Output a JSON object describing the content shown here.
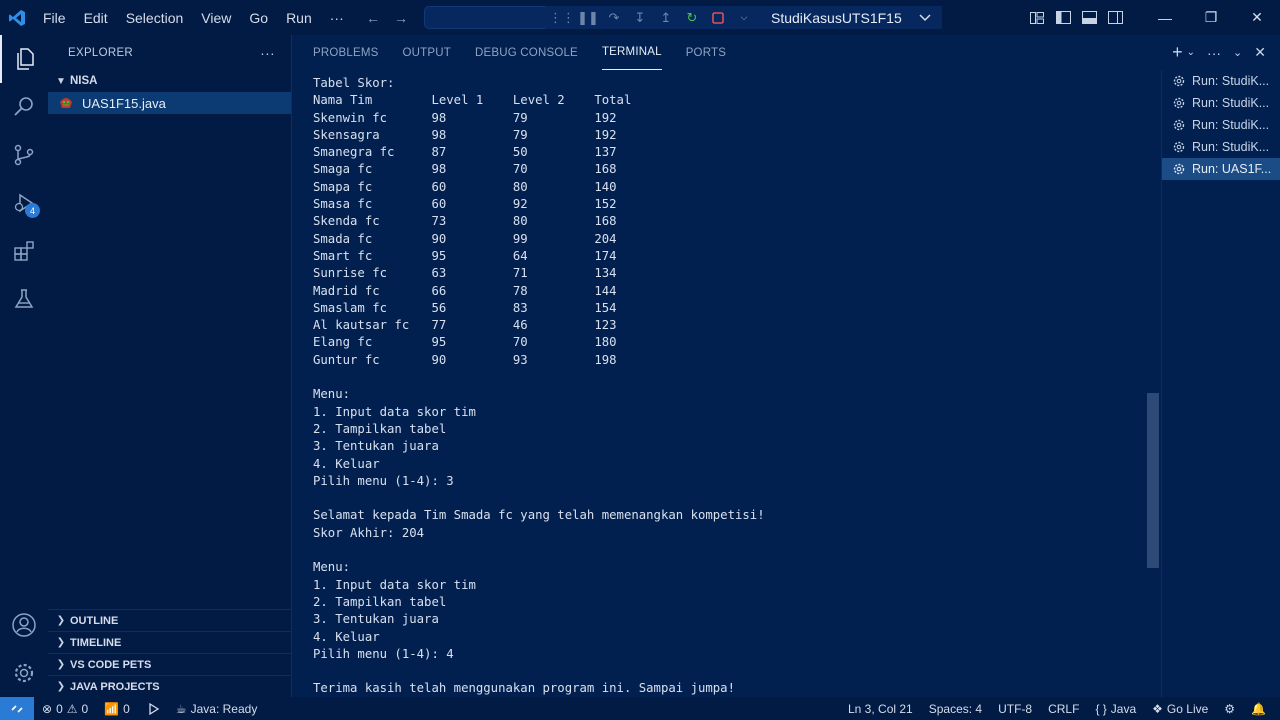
{
  "titlebar": {
    "menu": [
      "File",
      "Edit",
      "Selection",
      "View",
      "Go",
      "Run",
      "···"
    ],
    "debug_config": "StudiKasusUTS1F15"
  },
  "activitybar": {
    "debug_badge": "4"
  },
  "sidebar": {
    "title": "EXPLORER",
    "more": "···",
    "folder": "NISA",
    "file": "UAS1F15.java",
    "sections": [
      "OUTLINE",
      "TIMELINE",
      "VS CODE PETS",
      "JAVA PROJECTS"
    ]
  },
  "panel": {
    "tabs": [
      "PROBLEMS",
      "OUTPUT",
      "DEBUG CONSOLE",
      "TERMINAL",
      "PORTS"
    ],
    "active_tab": "TERMINAL",
    "terminals": [
      "Run: StudiK...",
      "Run: StudiK...",
      "Run: StudiK...",
      "Run: StudiK...",
      "Run: UAS1F..."
    ],
    "terminal_lines": [
      "Tabel Skor:",
      "Nama Tim        Level 1    Level 2    Total",
      "Skenwin fc      98         79         192",
      "Skensagra       98         79         192",
      "Smanegra fc     87         50         137",
      "Smaga fc        98         70         168",
      "Smapa fc        60         80         140",
      "Smasa fc        60         92         152",
      "Skenda fc       73         80         168",
      "Smada fc        90         99         204",
      "Smart fc        95         64         174",
      "Sunrise fc      63         71         134",
      "Madrid fc       66         78         144",
      "Smaslam fc      56         83         154",
      "Al kautsar fc   77         46         123",
      "Elang fc        95         70         180",
      "Guntur fc       90         93         198",
      "",
      "Menu:",
      "1. Input data skor tim",
      "2. Tampilkan tabel",
      "3. Tentukan juara",
      "4. Keluar",
      "Pilih menu (1-4): 3",
      "",
      "Selamat kepada Tim Smada fc yang telah memenangkan kompetisi!",
      "Skor Akhir: 204",
      "",
      "Menu:",
      "1. Input data skor tim",
      "2. Tampilkan tabel",
      "3. Tentukan juara",
      "4. Keluar",
      "Pilih menu (1-4): 4",
      "",
      "Terima kasih telah menggunakan program ini. Sampai jumpa!"
    ]
  },
  "statusbar": {
    "errors": "0",
    "warnings": "0",
    "ports": "0",
    "java_status": "Java: Ready",
    "position": "Ln 3, Col 21",
    "spaces": "Spaces: 4",
    "encoding": "UTF-8",
    "eol": "CRLF",
    "language": "Java",
    "golive": "Go Live"
  },
  "colors": {
    "accent": "#2a7bd6",
    "background": "#011f4f",
    "sidebar": "#011b45"
  }
}
